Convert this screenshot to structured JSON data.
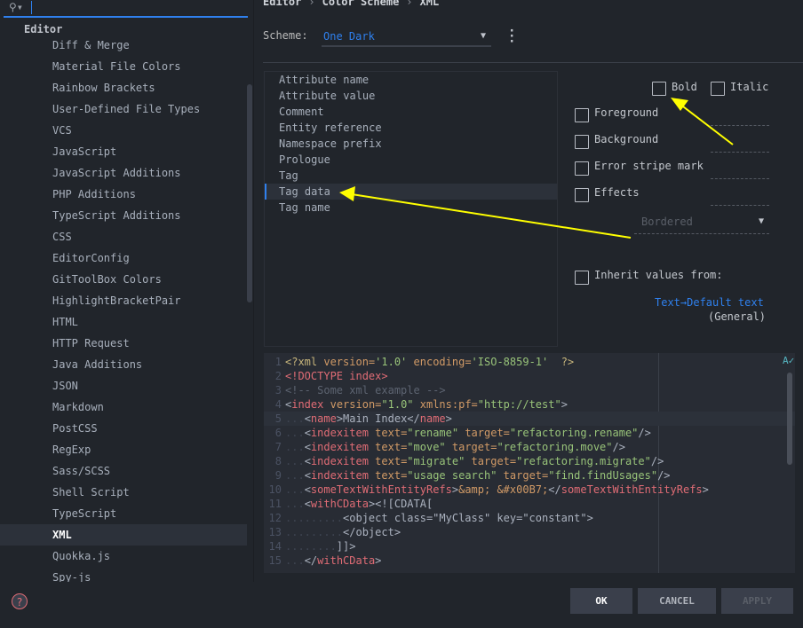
{
  "sidebar": {
    "search_value": "",
    "group": "Editor",
    "items": [
      "Diff & Merge",
      "Material File Colors",
      "Rainbow Brackets",
      "User-Defined File Types",
      "VCS",
      "JavaScript",
      "JavaScript Additions",
      "PHP Additions",
      "TypeScript Additions",
      "CSS",
      "EditorConfig",
      "GitToolBox Colors",
      "HighlightBracketPair",
      "HTML",
      "HTTP Request",
      "Java Additions",
      "JSON",
      "Markdown",
      "PostCSS",
      "RegExp",
      "Sass/SCSS",
      "Shell Script",
      "TypeScript",
      "XML",
      "Quokka.js",
      "Spy-js"
    ],
    "selected": "XML"
  },
  "breadcrumb": [
    "Editor",
    "Color Scheme",
    "XML"
  ],
  "scheme": {
    "label": "Scheme:",
    "value": "One Dark"
  },
  "attributes": {
    "items": [
      "Attribute name",
      "Attribute value",
      "Comment",
      "Entity reference",
      "Namespace prefix",
      "Prologue",
      "Tag",
      "Tag data",
      "Tag name"
    ],
    "selected": "Tag data"
  },
  "options": {
    "bold": "Bold",
    "italic": "Italic",
    "foreground": "Foreground",
    "background": "Background",
    "error_stripe": "Error stripe mark",
    "effects": "Effects",
    "effects_type": "Bordered",
    "inherit": "Inherit values from:",
    "inherit_link": "Text→Default text",
    "inherit_scope": "(General)"
  },
  "code": {
    "current_line": 5,
    "lines": [
      {
        "n": "1",
        "d": "",
        "t": [
          [
            "pi",
            "<?xml "
          ],
          [
            "attr",
            "version="
          ],
          [
            "str",
            "'1.0' "
          ],
          [
            "attr",
            "encoding="
          ],
          [
            "str",
            "'ISO-8859-1'"
          ],
          [
            "pi",
            "  ?>"
          ]
        ]
      },
      {
        "n": "2",
        "d": "",
        "t": [
          [
            "tag",
            "<!DOCTYPE index>"
          ]
        ]
      },
      {
        "n": "3",
        "d": "",
        "t": [
          [
            "com",
            "<!-- Some xml example -->"
          ]
        ]
      },
      {
        "n": "4",
        "d": "",
        "t": [
          [
            "txt",
            "<"
          ],
          [
            "tag",
            "index "
          ],
          [
            "attr",
            "version="
          ],
          [
            "str",
            "\"1.0\" "
          ],
          [
            "attr",
            "xmlns:pf="
          ],
          [
            "str",
            "\"http://test\""
          ],
          [
            "txt",
            ">"
          ]
        ]
      },
      {
        "n": "5",
        "d": "...",
        "t": [
          [
            "txt",
            "<"
          ],
          [
            "tag",
            "name"
          ],
          [
            "txt",
            ">Main Index</"
          ],
          [
            "tag",
            "name"
          ],
          [
            "txt",
            ">"
          ]
        ]
      },
      {
        "n": "6",
        "d": "...",
        "t": [
          [
            "txt",
            "<"
          ],
          [
            "tag",
            "indexitem "
          ],
          [
            "attr",
            "text="
          ],
          [
            "str",
            "\"rename\" "
          ],
          [
            "attr",
            "target="
          ],
          [
            "str",
            "\"refactoring.rename\""
          ],
          [
            "txt",
            "/>"
          ]
        ]
      },
      {
        "n": "7",
        "d": "...",
        "t": [
          [
            "txt",
            "<"
          ],
          [
            "tag",
            "indexitem "
          ],
          [
            "attr",
            "text="
          ],
          [
            "str",
            "\"move\" "
          ],
          [
            "attr",
            "target="
          ],
          [
            "str",
            "\"refactoring.move\""
          ],
          [
            "txt",
            "/>"
          ]
        ]
      },
      {
        "n": "8",
        "d": "...",
        "t": [
          [
            "txt",
            "<"
          ],
          [
            "tag",
            "indexitem "
          ],
          [
            "attr",
            "text="
          ],
          [
            "str",
            "\"migrate\" "
          ],
          [
            "attr",
            "target="
          ],
          [
            "str",
            "\"refactoring.migrate\""
          ],
          [
            "txt",
            "/>"
          ]
        ]
      },
      {
        "n": "9",
        "d": "...",
        "t": [
          [
            "txt",
            "<"
          ],
          [
            "tag",
            "indexitem "
          ],
          [
            "attr",
            "text="
          ],
          [
            "str",
            "\"usage search\" "
          ],
          [
            "attr",
            "target="
          ],
          [
            "str",
            "\"find.findUsages\""
          ],
          [
            "txt",
            "/>"
          ]
        ]
      },
      {
        "n": "10",
        "d": "...",
        "t": [
          [
            "txt",
            "<"
          ],
          [
            "tag",
            "someTextWithEntityRefs"
          ],
          [
            "txt",
            ">"
          ],
          [
            "attr",
            "&amp; &#x00B7;"
          ],
          [
            "txt",
            "</"
          ],
          [
            "tag",
            "someTextWithEntityRefs"
          ],
          [
            "txt",
            ">"
          ]
        ]
      },
      {
        "n": "11",
        "d": "...",
        "t": [
          [
            "txt",
            "<"
          ],
          [
            "tag",
            "withCData"
          ],
          [
            "txt",
            "><![CDATA["
          ]
        ]
      },
      {
        "n": "12",
        "d": ".........",
        "t": [
          [
            "txt",
            "<object class=\"MyClass\" key=\"constant\">"
          ]
        ]
      },
      {
        "n": "13",
        "d": ".........",
        "t": [
          [
            "txt",
            "</object>"
          ]
        ]
      },
      {
        "n": "14",
        "d": "........",
        "t": [
          [
            "txt",
            "]]>"
          ]
        ]
      },
      {
        "n": "15",
        "d": "...",
        "t": [
          [
            "txt",
            "</"
          ],
          [
            "tag",
            "withCData"
          ],
          [
            "txt",
            ">"
          ]
        ]
      }
    ]
  },
  "buttons": {
    "ok": "OK",
    "cancel": "CANCEL",
    "apply": "APPLY"
  },
  "colors": {
    "accent": "#2f80ed",
    "annotation_arrow": "#ffff00"
  }
}
